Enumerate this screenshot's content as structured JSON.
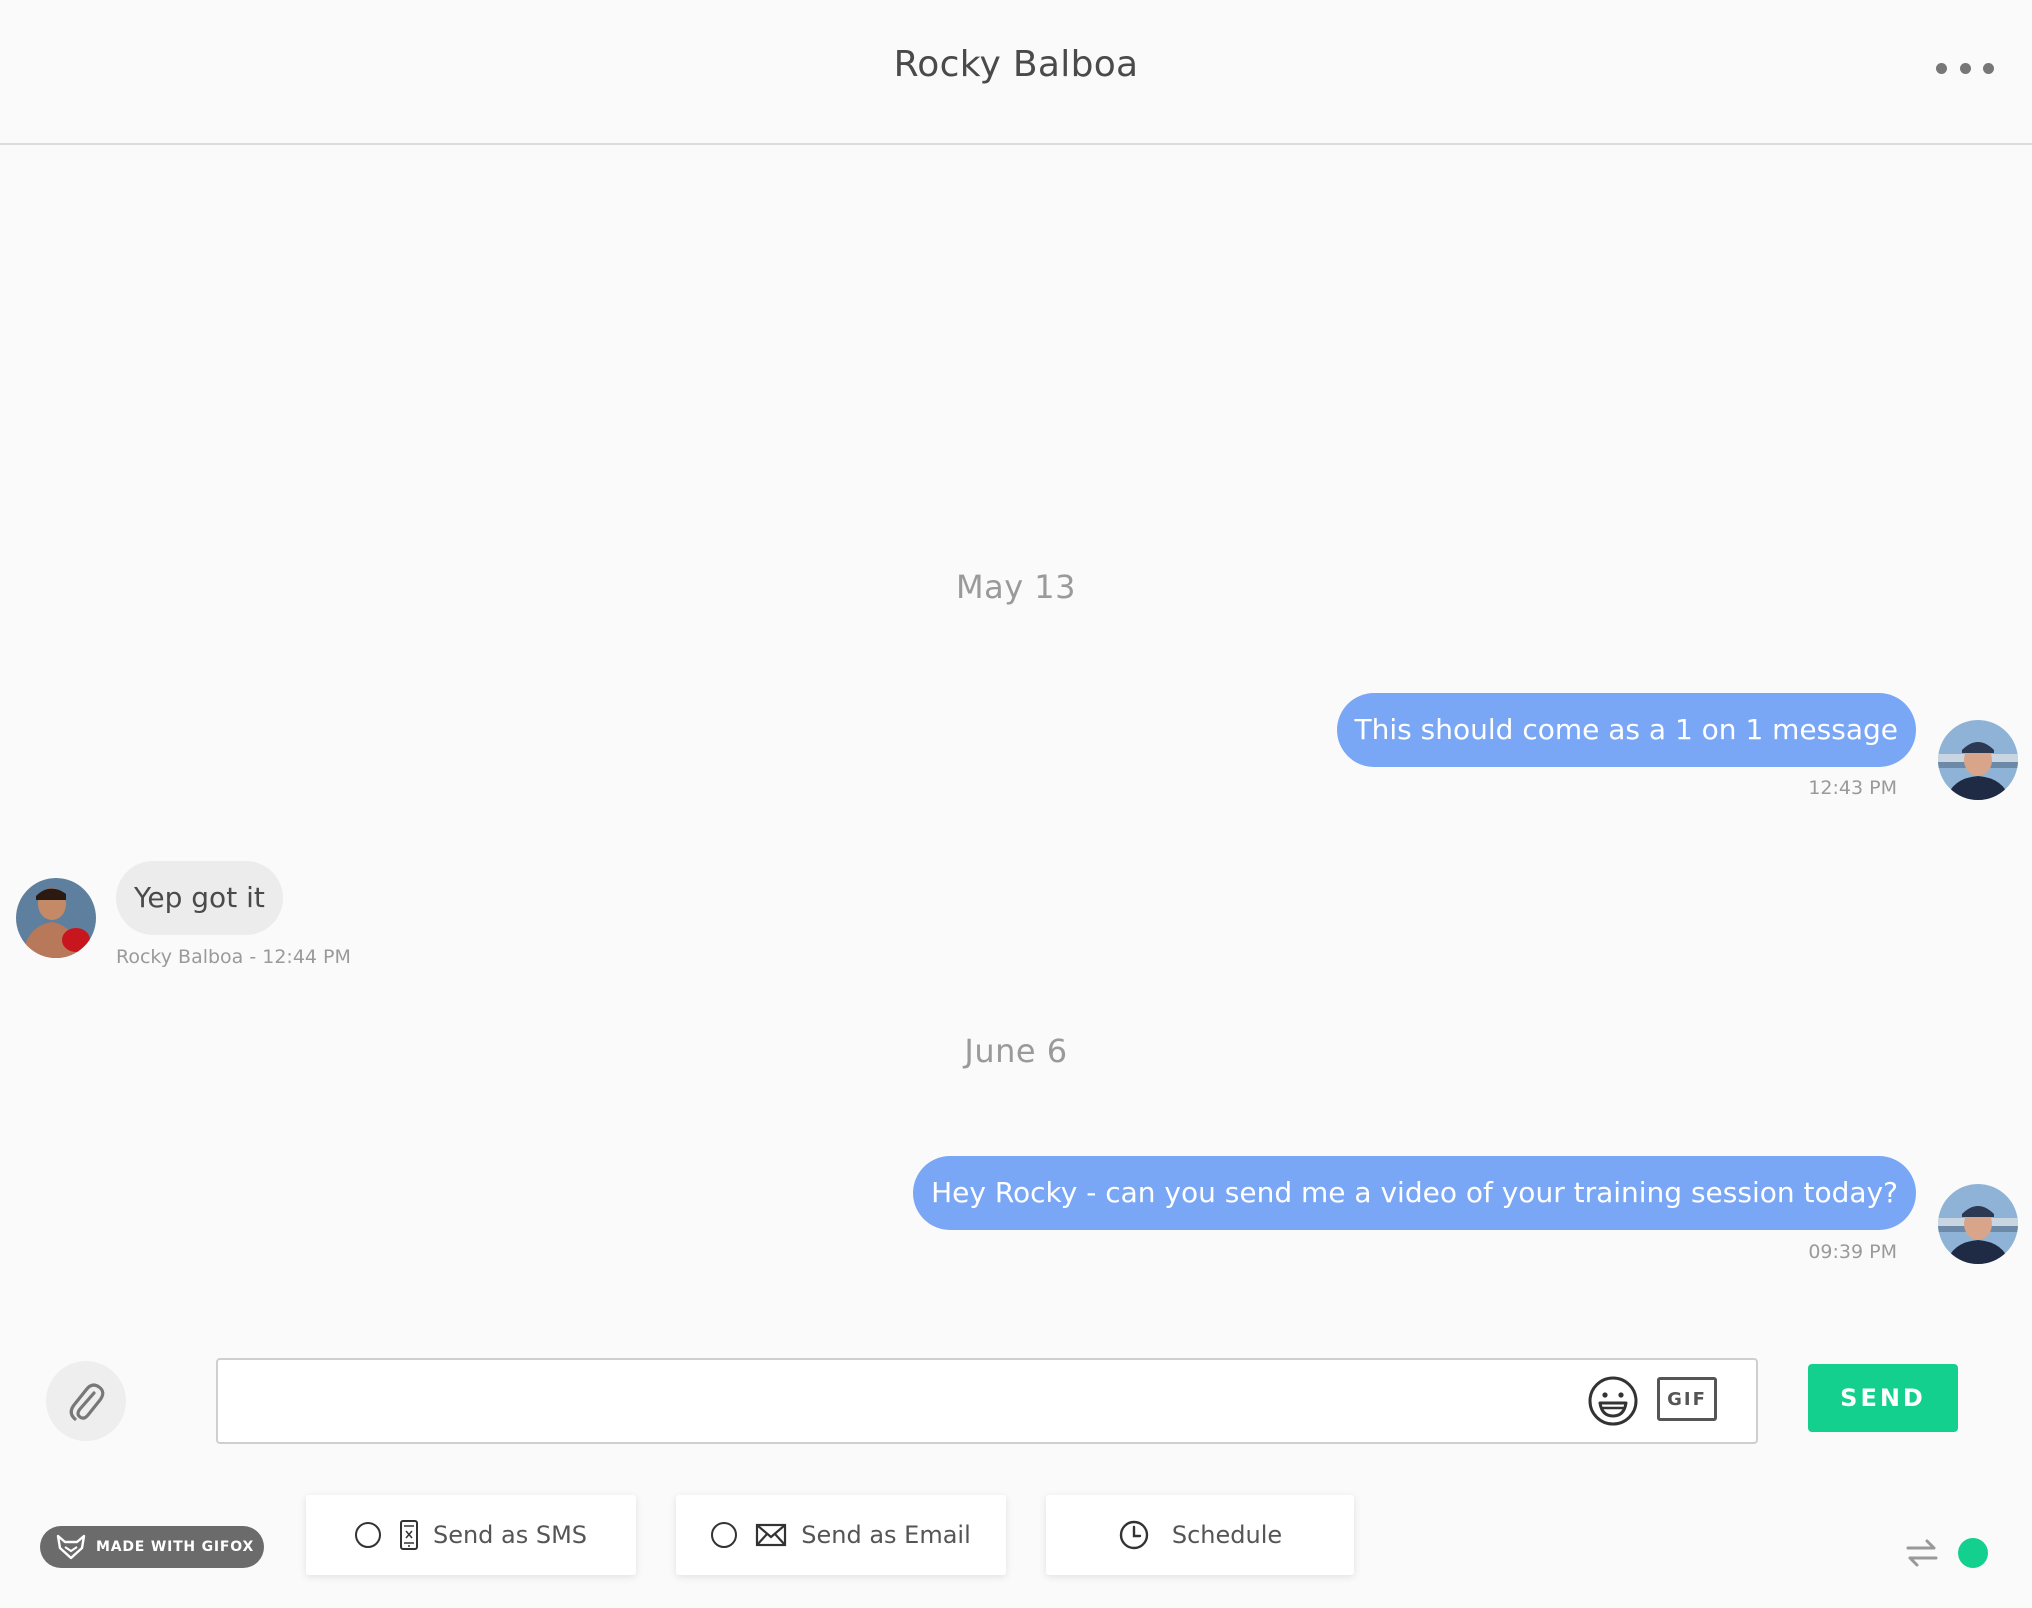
{
  "header": {
    "title": "Rocky Balboa",
    "more_icon": "more-horizontal-icon"
  },
  "conversation": {
    "groups": [
      {
        "date": "May 13",
        "messages": [
          {
            "direction": "outgoing",
            "text": "This should come as a 1 on 1 message",
            "meta": "12:43 PM"
          },
          {
            "direction": "incoming",
            "text": "Yep got it",
            "meta": "Rocky Balboa - 12:44 PM"
          }
        ]
      },
      {
        "date": "June 6",
        "messages": [
          {
            "direction": "outgoing",
            "text": "Hey Rocky - can you send me a video of your training session today?",
            "meta": "09:39 PM"
          }
        ]
      }
    ]
  },
  "composer": {
    "input_value": "",
    "attach_icon": "paperclip-icon",
    "emoji_icon": "emoji-icon",
    "gif_label": "GIF",
    "send_label": "SEND"
  },
  "options": {
    "badge_label": "MADE WITH GIFOX",
    "sms_label": "Send as SMS",
    "email_label": "Send as Email",
    "schedule_label": "Schedule"
  },
  "colors": {
    "outgoing_bubble": "#7aa7f5",
    "incoming_bubble": "#ececec",
    "accent_green": "#13d08f"
  }
}
